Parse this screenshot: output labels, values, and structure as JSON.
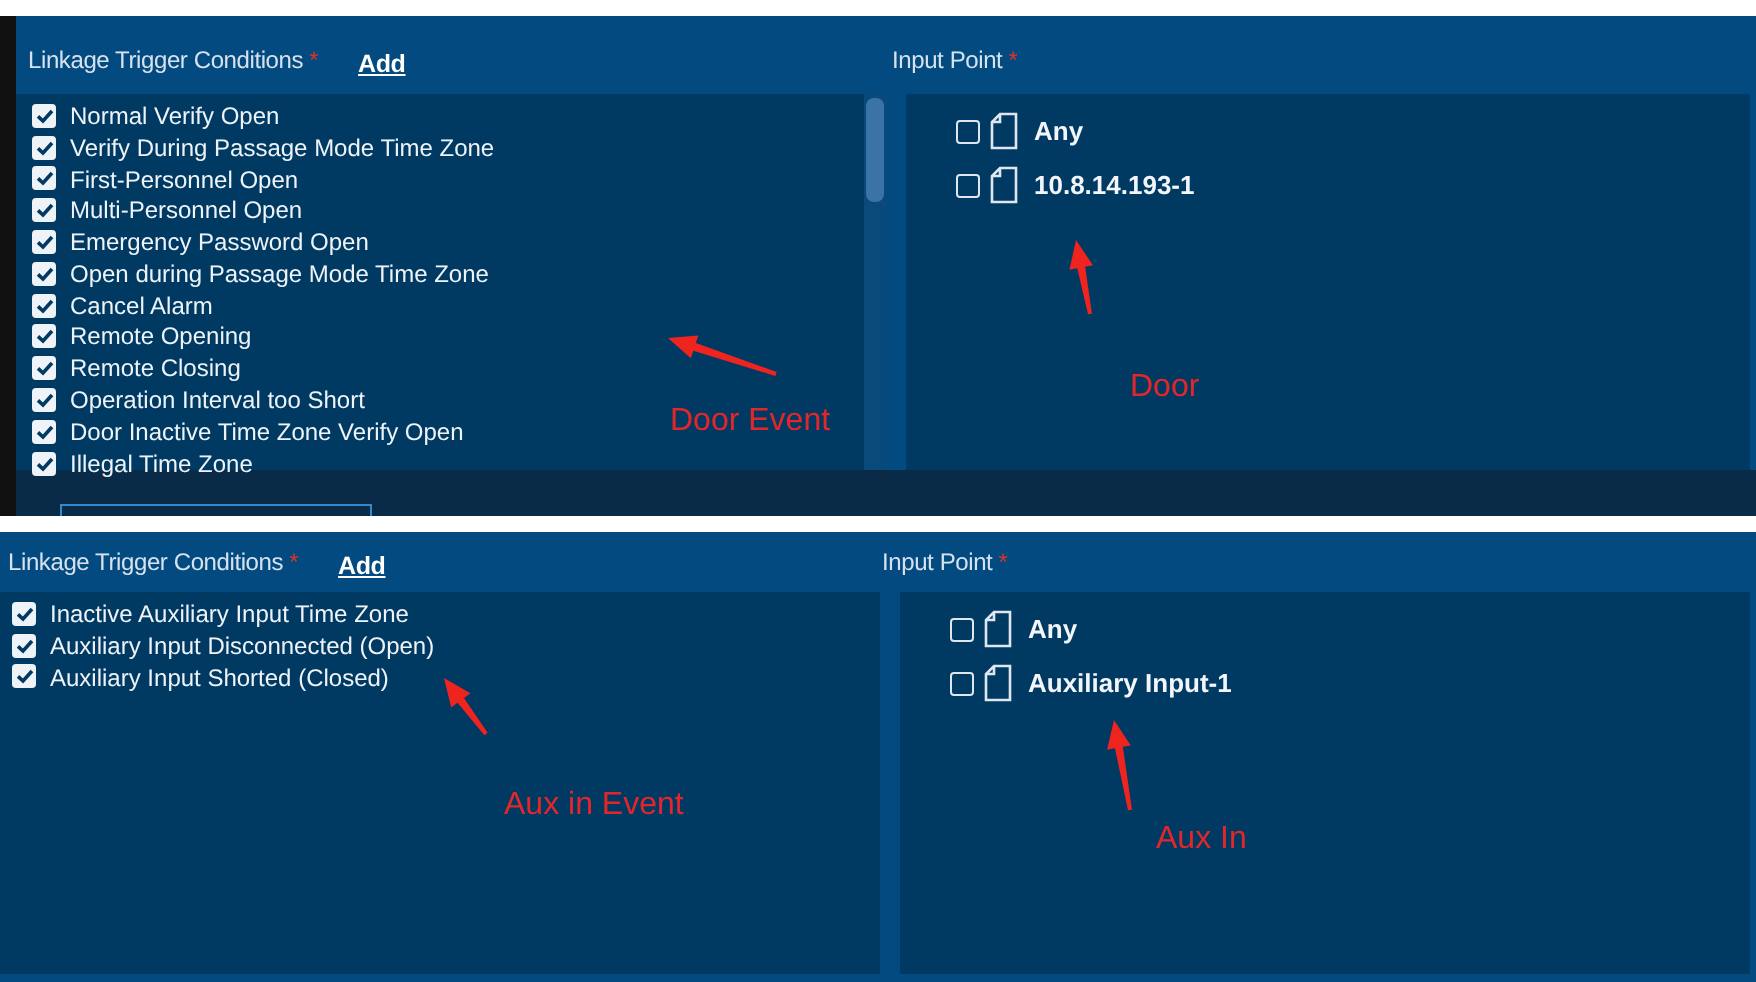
{
  "panels": [
    {
      "conditions": {
        "label": "Linkage Trigger Conditions",
        "required_mark": "*",
        "add_link": "Add",
        "items": [
          {
            "label": "Normal Verify Open",
            "checked": true
          },
          {
            "label": "Verify During Passage Mode Time Zone",
            "checked": true
          },
          {
            "label": "First-Personnel Open",
            "checked": true
          },
          {
            "label": "Multi-Personnel Open",
            "checked": true
          },
          {
            "label": "Emergency Password Open",
            "checked": true
          },
          {
            "label": "Open during Passage Mode Time Zone",
            "checked": true
          },
          {
            "label": "Cancel Alarm",
            "checked": true
          },
          {
            "label": "Remote Opening",
            "checked": true
          },
          {
            "label": "Remote Closing",
            "checked": true
          },
          {
            "label": "Operation Interval too Short",
            "checked": true
          },
          {
            "label": "Door Inactive Time Zone Verify Open",
            "checked": true
          },
          {
            "label": "Illegal Time Zone",
            "checked": true
          }
        ],
        "note": "Door Event"
      },
      "input_point": {
        "label": "Input Point",
        "required_mark": "*",
        "items": [
          {
            "label": "Any",
            "checked": false
          },
          {
            "label": "10.8.14.193-1",
            "checked": false
          }
        ],
        "note": "Door"
      }
    },
    {
      "conditions": {
        "label": "Linkage Trigger Conditions",
        "required_mark": "*",
        "add_link": "Add",
        "items": [
          {
            "label": "Inactive Auxiliary Input Time Zone",
            "checked": true
          },
          {
            "label": "Auxiliary Input Disconnected (Open)",
            "checked": true
          },
          {
            "label": "Auxiliary Input Shorted (Closed)",
            "checked": true
          }
        ],
        "note": "Aux in Event"
      },
      "input_point": {
        "label": "Input Point",
        "required_mark": "*",
        "items": [
          {
            "label": "Any",
            "checked": false
          },
          {
            "label": "Auxiliary Input-1",
            "checked": false
          }
        ],
        "note": "Aux In"
      }
    }
  ]
}
